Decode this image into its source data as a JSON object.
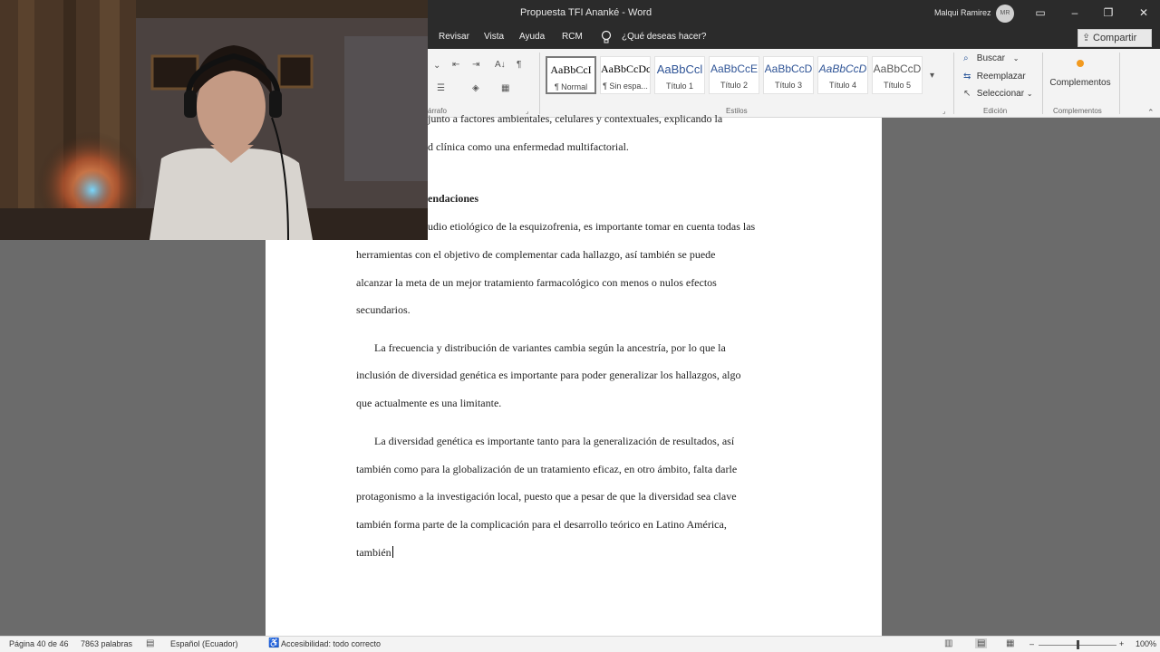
{
  "titlebar": {
    "doc_title": "Propuesta TFI Ananké  -  Word",
    "user_name": "Malqui Ramirez",
    "user_initials": "MR"
  },
  "tabs": {
    "items": [
      "Revisar",
      "Vista",
      "Ayuda",
      "RCM"
    ],
    "tell_me": "¿Qué deseas hacer?",
    "share_label": "Compartir"
  },
  "ribbon": {
    "paragraph_group_label": "árrafo",
    "styles_group_label": "Estilos",
    "edit_group_label": "Edición",
    "addins_group_label": "Complementos",
    "styles": [
      {
        "preview": "AaBbCcI",
        "name": "¶ Normal"
      },
      {
        "preview": "AaBbCcDc",
        "name": "¶ Sin espa..."
      },
      {
        "preview": "AaBbCcl",
        "name": "Título 1"
      },
      {
        "preview": "AaBbCcE",
        "name": "Título 2"
      },
      {
        "preview": "AaBbCcD",
        "name": "Título 3"
      },
      {
        "preview": "AaBbCcD",
        "name": "Título 4"
      },
      {
        "preview": "AaBbCcD",
        "name": "Título 5"
      }
    ],
    "find_label": "Buscar",
    "replace_label": "Reemplazar",
    "select_label": "Seleccionar",
    "addins_label": "Complementos"
  },
  "document": {
    "lines": [
      "junto a factores ambientales, celulares y contextuales, explicando la",
      "d clínica como una enfermedad multifactorial.",
      "endaciones",
      "udio etiológico de la esquizofrenia, es importante tomar en cuenta todas las",
      "herramientas con el objetivo de complementar cada hallazgo, así también se puede",
      "alcanzar la meta de un mejor tratamiento farmacológico con menos o nulos efectos",
      "secundarios.",
      "La frecuencia y distribución de variantes cambia según la ancestría, por lo que la",
      "inclusión de diversidad genética es importante para poder generalizar los hallazgos, algo",
      "que actualmente es una limitante.",
      "La diversidad genética es importante tanto para la generalización de resultados, así",
      "también como para la globalización de un tratamiento eficaz, en otro ámbito, falta darle",
      "protagonismo a la investigación local, puesto que a pesar de que la diversidad sea clave",
      "también forma parte de la complicación para el desarrollo teórico en Latino América,",
      "también"
    ]
  },
  "statusbar": {
    "page": "Página 40 de 46",
    "words": "7863 palabras",
    "language": "Español (Ecuador)",
    "accessibility": "Accesibilidad: todo correcto",
    "zoom": "100%"
  },
  "colors": {
    "titlebar_bg": "#2b2b2b",
    "ribbon_bg": "#f3f3f3",
    "workspace_bg": "#6b6b6b",
    "heading_blue": "#2f5496",
    "addin_orange": "#f29a1f"
  }
}
